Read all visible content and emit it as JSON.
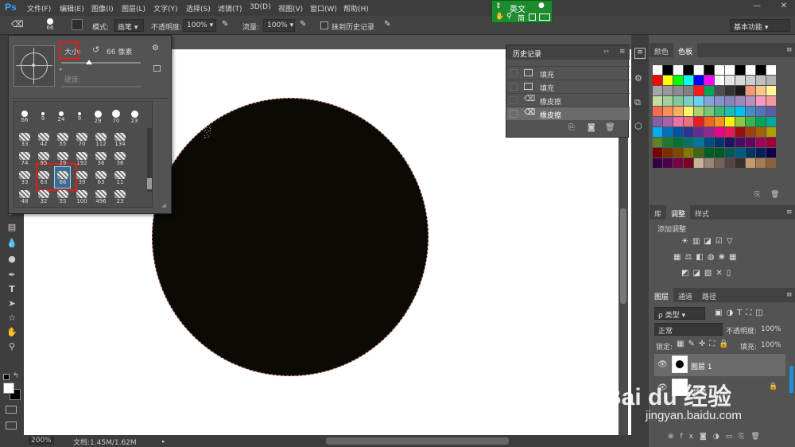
{
  "menubar": {
    "logo": "Ps",
    "items": [
      "文件(F)",
      "编辑(E)",
      "图像(I)",
      "图层(L)",
      "文字(Y)",
      "选择(S)",
      "滤镜(T)",
      "3D(D)",
      "视图(V)",
      "窗口(W)",
      "帮助(H)"
    ],
    "minimize": "—",
    "close": "✕"
  },
  "ime": {
    "lang": "英文",
    "row2": "简",
    "indicator": "●"
  },
  "options": {
    "brush_size": "66",
    "mode_label": "模式:",
    "mode_value": "画笔",
    "opacity_label": "不透明度:",
    "opacity_value": "100%",
    "flow_label": "流量:",
    "flow_value": "100%",
    "erase_history_label": "抹到历史记录",
    "workspace": "基本功能"
  },
  "brush_picker": {
    "size_label": "大小:",
    "size_value": "66 像素",
    "hardness_label": "硬度:",
    "row1_sizes": [
      "66",
      "9",
      "24",
      "9",
      "29",
      "70",
      "23"
    ],
    "grid_sizes": [
      [
        "33",
        "42",
        "55",
        "70",
        "112",
        "134"
      ],
      [
        "74",
        "95",
        "29",
        "192",
        "36",
        "36"
      ],
      [
        "33",
        "63",
        "66",
        "39",
        "63",
        "11"
      ],
      [
        "48",
        "32",
        "55",
        "100",
        "496",
        "23"
      ]
    ]
  },
  "history": {
    "title": "历史记录",
    "items": [
      "填充",
      "填充",
      "橡皮擦",
      "橡皮擦"
    ]
  },
  "color_panel": {
    "tabs": [
      "颜色",
      "色板"
    ],
    "active": "色板"
  },
  "adjust_panel": {
    "tabs": [
      "库",
      "调整",
      "样式"
    ],
    "active": "调整",
    "add_label": "添加调整"
  },
  "layers_panel": {
    "tabs": [
      "图层",
      "通道",
      "路径"
    ],
    "active": "图层",
    "filter_kind": "ρ 类型",
    "blend_mode": "正常",
    "opacity_label": "不透明度:",
    "opacity_value": "100%",
    "lock_label": "锁定:",
    "fill_label": "填充:",
    "fill_value": "100%",
    "layers": [
      {
        "name": "图层 1",
        "selected": true
      },
      {
        "name": "背景",
        "selected": false
      }
    ]
  },
  "status": {
    "zoom": "200%",
    "doc": "文档:1.45M/1.62M"
  },
  "watermark": {
    "brand": "Bai du 经验",
    "url": "jingyan.baidu.com"
  },
  "colors": {
    "accent": "#31a8ff",
    "highlight": "#e21b1b",
    "ime": "#1e8b2e",
    "fill_circle": "#0c0a05"
  }
}
